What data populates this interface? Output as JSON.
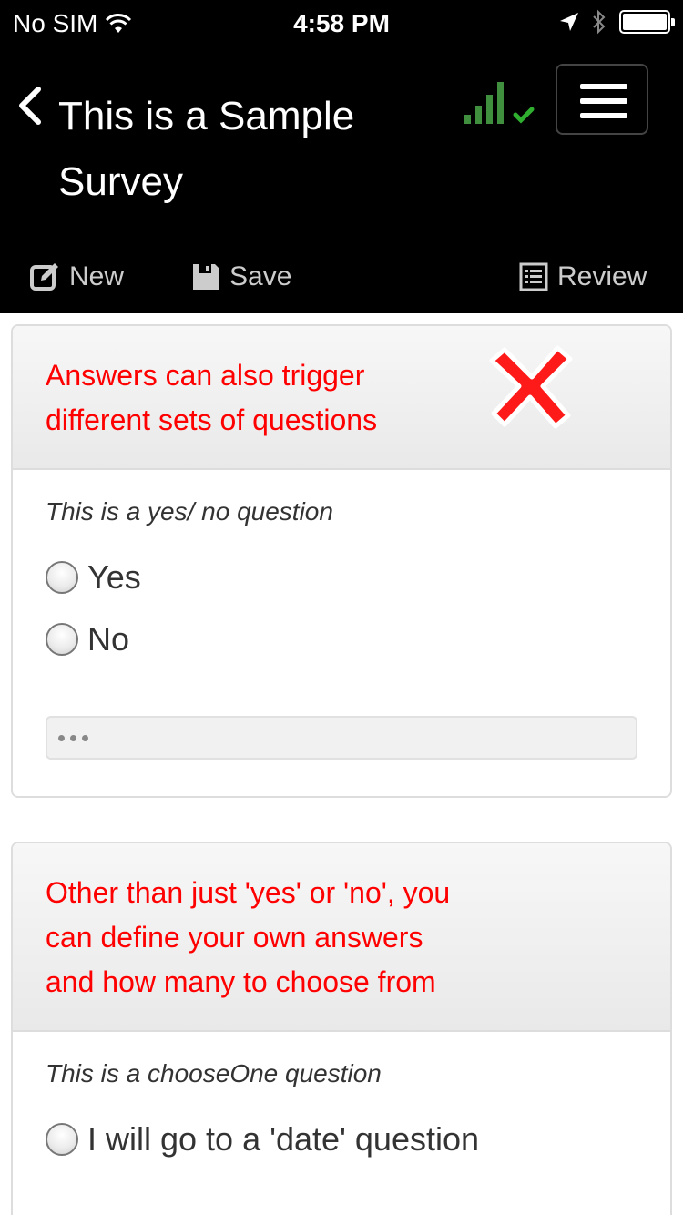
{
  "status_bar": {
    "carrier": "No SIM",
    "time": "4:58 PM",
    "icons": [
      "wifi-icon",
      "location-arrow-icon",
      "bluetooth-icon",
      "battery-icon"
    ]
  },
  "header": {
    "title": "This is a Sample Survey",
    "back_icon": "chevron-left-icon",
    "signal_icon": "signal-bars-check-icon",
    "menu_icon": "hamburger-menu-icon",
    "signal_color": "#2e8b2e"
  },
  "toolbar": {
    "new_label": "New",
    "save_label": "Save",
    "review_label": "Review"
  },
  "panels": [
    {
      "title": "Answers can also trigger different sets of questions",
      "question": "This is a yes/ no question",
      "options": [
        "Yes",
        "No"
      ],
      "annotation_icon": "red-x-icon"
    },
    {
      "title": "Other than just 'yes' or 'no', you can define your own answers and how many to choose from",
      "question": "This is a chooseOne question",
      "options": [
        "I will go to a 'date' question"
      ]
    }
  ],
  "colors": {
    "accent_red": "#ff0000",
    "header_bg": "#000000"
  }
}
